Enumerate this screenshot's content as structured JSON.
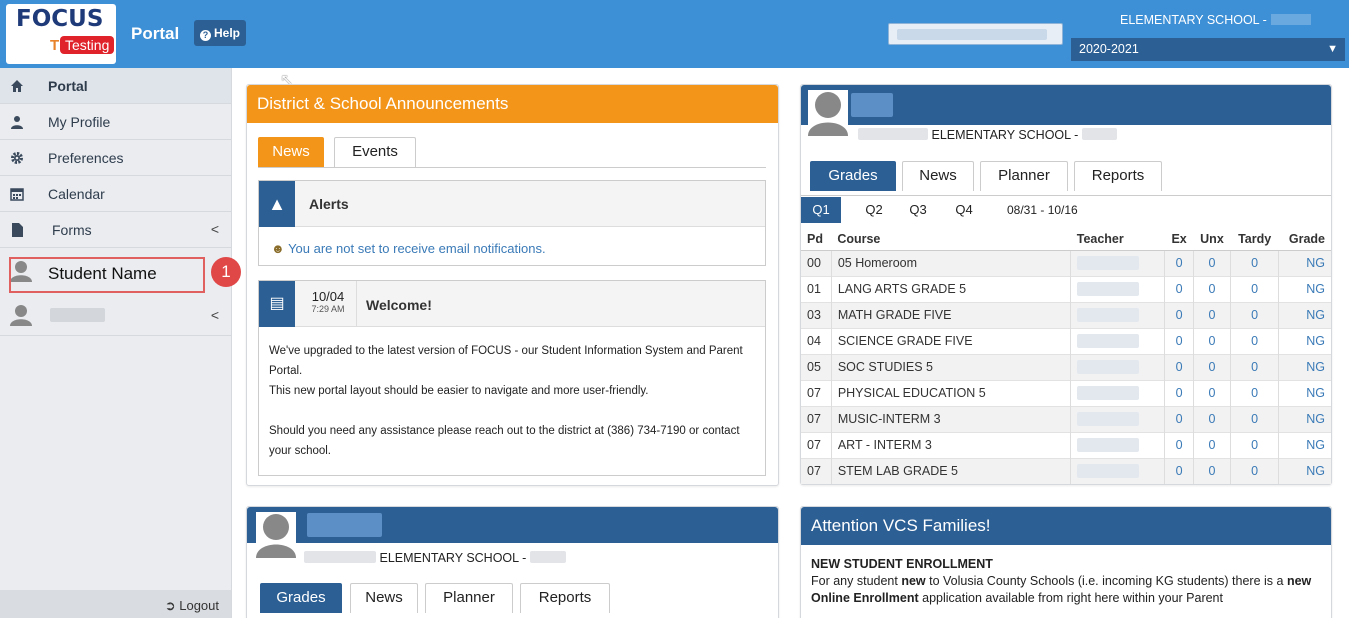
{
  "header": {
    "logo_text": "FOCUS",
    "logo_badge": "Testing",
    "logo_t": "T",
    "portal_label": "Portal",
    "help_label": "Help",
    "school_name": "ELEMENTARY SCHOOL -",
    "year": "2020-2021",
    "year_arrow": "▼"
  },
  "sidebar": {
    "items": [
      {
        "label": "Portal",
        "icon": "home-icon"
      },
      {
        "label": "My Profile",
        "icon": "user-icon"
      },
      {
        "label": "Preferences",
        "icon": "gear-icon"
      },
      {
        "label": "Calendar",
        "icon": "calendar-icon"
      },
      {
        "label": "Forms",
        "icon": "document-icon"
      }
    ],
    "student_name": "Student Name",
    "callout_number": "1",
    "logout_label": "Logout"
  },
  "announcements": {
    "title": "District & School Announcements",
    "tabs": [
      "News",
      "Events"
    ],
    "alerts_title": "Alerts",
    "alerts_message": "You are not set to receive email notifications.",
    "welcome_date": "10/04",
    "welcome_time": "7:29 AM",
    "welcome_title": "Welcome!",
    "welcome_p1": "We've upgraded to the latest version of FOCUS - our Student Information System and Parent Portal.",
    "welcome_p2": "This new portal layout should be easier to navigate and more user-friendly.",
    "welcome_p3": "Should you need any assistance please reach out to the district at (386) 734-7190 or contact your school."
  },
  "student_card": {
    "school": "ELEMENTARY SCHOOL -",
    "tabs": [
      "Grades",
      "News",
      "Planner",
      "Reports"
    ],
    "quarters": [
      "Q1",
      "Q2",
      "Q3",
      "Q4"
    ],
    "date_range": "08/31 - 10/16",
    "columns": [
      "Pd",
      "Course",
      "Teacher",
      "Ex",
      "Unx",
      "Tardy",
      "Grade"
    ],
    "rows": [
      {
        "pd": "00",
        "course": "05 Homeroom",
        "ex": "0",
        "unx": "0",
        "tardy": "0",
        "grade": "NG"
      },
      {
        "pd": "01",
        "course": "LANG ARTS GRADE 5",
        "ex": "0",
        "unx": "0",
        "tardy": "0",
        "grade": "NG"
      },
      {
        "pd": "03",
        "course": "MATH GRADE FIVE",
        "ex": "0",
        "unx": "0",
        "tardy": "0",
        "grade": "NG"
      },
      {
        "pd": "04",
        "course": "SCIENCE GRADE FIVE",
        "ex": "0",
        "unx": "0",
        "tardy": "0",
        "grade": "NG"
      },
      {
        "pd": "05",
        "course": "SOC STUDIES 5",
        "ex": "0",
        "unx": "0",
        "tardy": "0",
        "grade": "NG"
      },
      {
        "pd": "07",
        "course": "PHYSICAL EDUCATION 5",
        "ex": "0",
        "unx": "0",
        "tardy": "0",
        "grade": "NG"
      },
      {
        "pd": "07",
        "course": "MUSIC-INTERM 3",
        "ex": "0",
        "unx": "0",
        "tardy": "0",
        "grade": "NG"
      },
      {
        "pd": "07",
        "course": "ART - INTERM 3",
        "ex": "0",
        "unx": "0",
        "tardy": "0",
        "grade": "NG"
      },
      {
        "pd": "07",
        "course": "STEM LAB GRADE 5",
        "ex": "0",
        "unx": "0",
        "tardy": "0",
        "grade": "NG"
      }
    ]
  },
  "student_card_2": {
    "school": "ELEMENTARY SCHOOL -",
    "tabs": [
      "Grades",
      "News",
      "Planner",
      "Reports"
    ]
  },
  "attention": {
    "title": "Attention VCS Families!",
    "heading": "NEW STUDENT ENROLLMENT",
    "t1": "For any student ",
    "b1": "new",
    "t2": " to Volusia County Schools (i.e. incoming KG students) there is a ",
    "b2": "new Online Enrollment",
    "t3": " application available from right here within your Parent"
  },
  "colors": {
    "topbar": "#3d8fd6",
    "navy": "#2c5f94",
    "orange": "#f39519",
    "link": "#3a7ab7",
    "callout": "#e04848"
  }
}
